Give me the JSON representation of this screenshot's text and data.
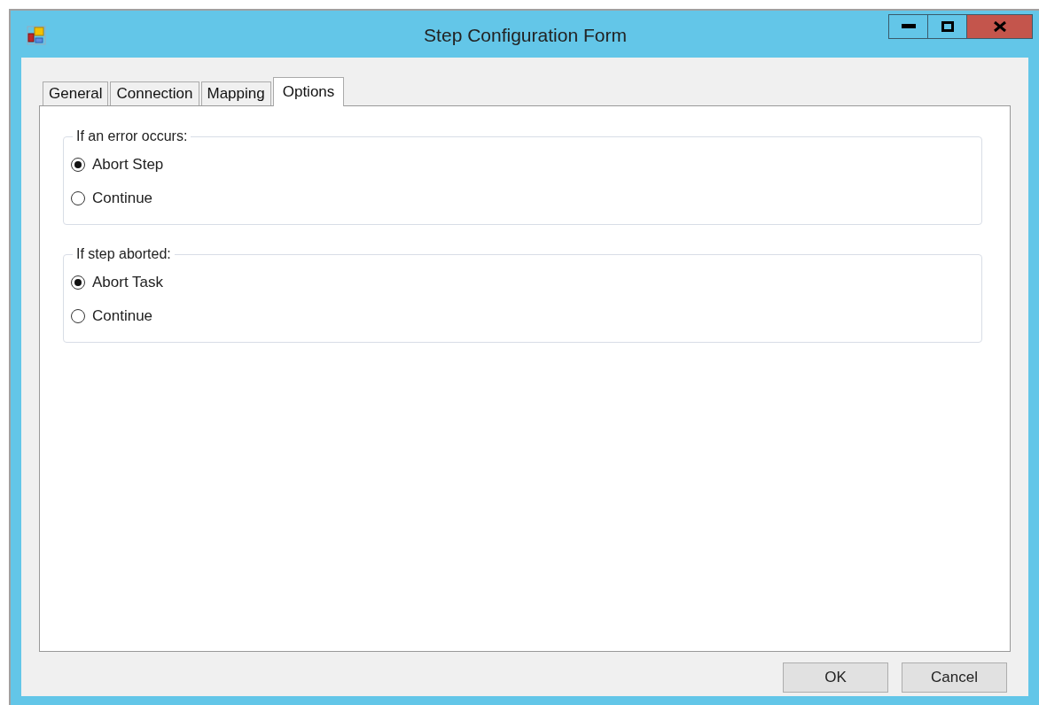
{
  "window": {
    "title": "Step Configuration Form"
  },
  "tabs": [
    {
      "label": "General",
      "selected": false
    },
    {
      "label": "Connection",
      "selected": false
    },
    {
      "label": "Mapping",
      "selected": false
    },
    {
      "label": "Options",
      "selected": true
    }
  ],
  "groups": [
    {
      "title": "If an error occurs:",
      "options": [
        {
          "label": "Abort Step",
          "selected": true
        },
        {
          "label": "Continue",
          "selected": false
        }
      ]
    },
    {
      "title": "If step aborted:",
      "options": [
        {
          "label": "Abort Task",
          "selected": true
        },
        {
          "label": "Continue",
          "selected": false
        }
      ]
    }
  ],
  "buttons": [
    "OK",
    "Cancel"
  ]
}
